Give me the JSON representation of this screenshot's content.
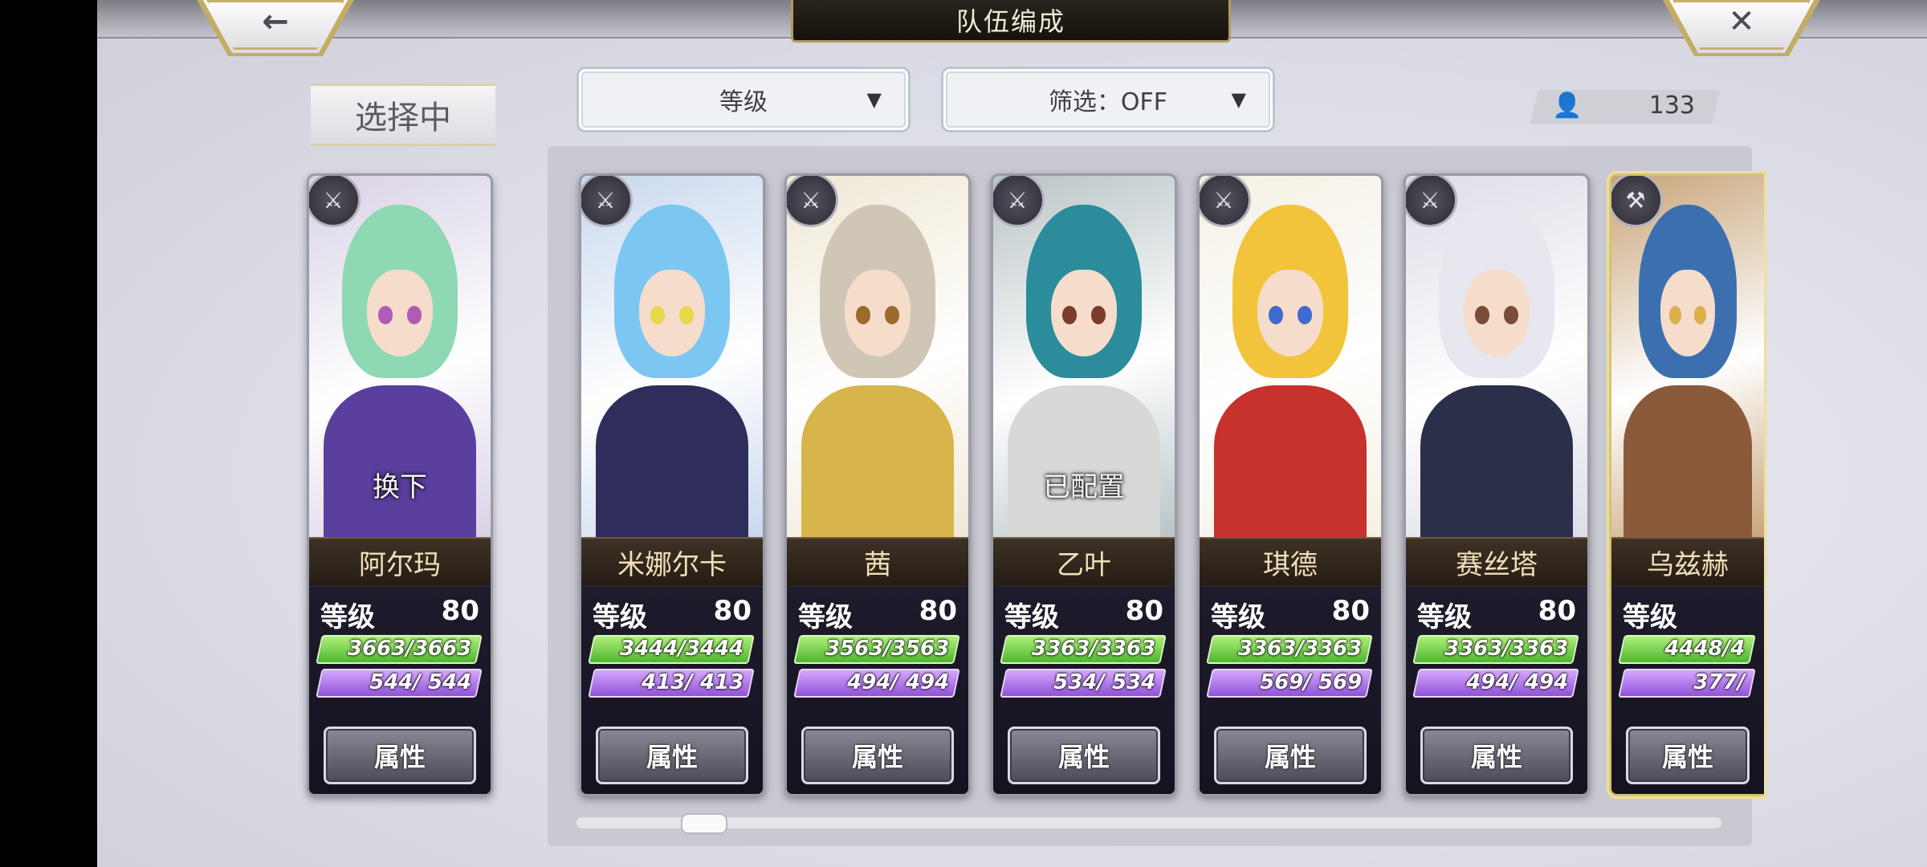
{
  "header": {
    "title": "队伍编成",
    "back_icon": "←",
    "close_icon": "✕"
  },
  "selecting": {
    "label": "选择中"
  },
  "sort": {
    "value": "等级",
    "arrow": "▼"
  },
  "filter": {
    "value": "筛选：OFF",
    "arrow": "▼"
  },
  "roster_count": {
    "icon": "person-icon",
    "value": "133"
  },
  "cards": [
    {
      "name": "阿尔玛",
      "level_label": "等级",
      "level": "80",
      "hp": "3663/3663",
      "hp_fill": 1.0,
      "mp": "544/  544",
      "mp_fill": 1.0,
      "overlay": "换下",
      "attr_label": "属性",
      "class_icon": "staff-icon",
      "badge": "⚔",
      "colors": {
        "bg": "#d9d2e6",
        "hair": "#8fd8b4",
        "eye": "#b05bb5",
        "body": "#5a3f9e"
      }
    },
    {
      "name": "米娜尔卡",
      "level_label": "等级",
      "level": "80",
      "hp": "3444/3444",
      "hp_fill": 1.0,
      "mp": "413/  413",
      "mp_fill": 1.0,
      "overlay": "",
      "attr_label": "属性",
      "class_icon": "sword-icon",
      "badge": "⚔",
      "colors": {
        "bg": "#c9d8ee",
        "hair": "#7cc7f2",
        "eye": "#e8d74a",
        "body": "#2f2d5c"
      }
    },
    {
      "name": "茜",
      "level_label": "等级",
      "level": "80",
      "hp": "3563/3563",
      "hp_fill": 1.0,
      "mp": "494/  494",
      "mp_fill": 1.0,
      "overlay": "",
      "attr_label": "属性",
      "class_icon": "blade-icon",
      "badge": "⚔",
      "colors": {
        "bg": "#efe8d6",
        "hair": "#cfc6b6",
        "eye": "#9c6a2d",
        "body": "#d8b54a"
      }
    },
    {
      "name": "乙叶",
      "level_label": "等级",
      "level": "80",
      "hp": "3363/3363",
      "hp_fill": 1.0,
      "mp": "534/  534",
      "mp_fill": 1.0,
      "overlay": "已配置",
      "attr_label": "属性",
      "class_icon": "blade-icon",
      "badge": "⚔",
      "colors": {
        "bg": "#b9c4c6",
        "hair": "#2b8c9c",
        "eye": "#7a3d2a",
        "body": "#d7d9d6"
      }
    },
    {
      "name": "琪德",
      "level_label": "等级",
      "level": "80",
      "hp": "3363/3363",
      "hp_fill": 1.0,
      "mp": "569/  569",
      "mp_fill": 1.0,
      "overlay": "",
      "attr_label": "属性",
      "class_icon": "blade-icon",
      "badge": "⚔",
      "colors": {
        "bg": "#f4f0e4",
        "hair": "#f2c43c",
        "eye": "#3f6ad0",
        "body": "#c7322c"
      }
    },
    {
      "name": "赛丝塔",
      "level_label": "等级",
      "level": "80",
      "hp": "3363/3363",
      "hp_fill": 1.0,
      "mp": "494/  494",
      "mp_fill": 1.0,
      "overlay": "",
      "attr_label": "属性",
      "class_icon": "blade-icon",
      "badge": "⚔",
      "colors": {
        "bg": "#dcdde8",
        "hair": "#e8e6ee",
        "eye": "#7a4a3a",
        "body": "#2a2f4a"
      }
    },
    {
      "name": "乌兹赫",
      "level_label": "等级",
      "level": "",
      "hp": "4448/4",
      "hp_fill": 1.0,
      "mp": "377/",
      "mp_fill": 1.0,
      "overlay": "",
      "attr_label": "属性",
      "class_icon": "axe-icon",
      "badge": "⚒",
      "colors": {
        "bg": "#c9a57a",
        "hair": "#3c6fb0",
        "eye": "#d9b04a",
        "body": "#8a5a3a"
      }
    }
  ]
}
